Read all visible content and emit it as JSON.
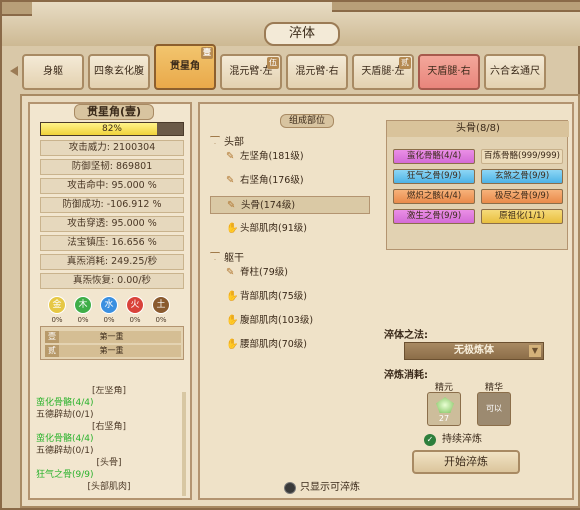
{
  "window": {
    "title": "淬体"
  },
  "tabs": [
    {
      "label": "身躯",
      "state": "normal"
    },
    {
      "label": "四象玄化腹",
      "state": "normal"
    },
    {
      "label": "贯星角",
      "state": "active",
      "badge": "壹"
    },
    {
      "label": "混元臂·左",
      "state": "normal",
      "badge": "伍"
    },
    {
      "label": "混元臂·右",
      "state": "normal"
    },
    {
      "label": "天盾腿·左",
      "state": "normal",
      "badge": "贰"
    },
    {
      "label": "天盾腿·右",
      "state": "red"
    },
    {
      "label": "六合玄通尺",
      "state": "normal"
    }
  ],
  "left": {
    "name": "贯星角(壹)",
    "progress": {
      "value": 82,
      "label": "82%"
    },
    "stats": [
      {
        "label": "攻击威力: 2100304"
      },
      {
        "label": "防御坚韧: 869801"
      },
      {
        "label": "攻击命中: 95.000 %"
      },
      {
        "label": "防御成功: -106.912 %"
      },
      {
        "label": "攻击穿透: 95.000 %"
      },
      {
        "label": "法宝镇压: 16.656 %"
      },
      {
        "label": "真炁消耗: 249.25/秒"
      },
      {
        "label": "真炁恢复: 0.00/秒"
      }
    ],
    "elements": [
      {
        "char": "金",
        "pct": "0%",
        "color": "#e6c845"
      },
      {
        "char": "木",
        "pct": "0%",
        "color": "#3fae48"
      },
      {
        "char": "水",
        "pct": "0%",
        "color": "#3a8fe0"
      },
      {
        "char": "火",
        "pct": "0%",
        "color": "#d9423a"
      },
      {
        "char": "土",
        "pct": "0%",
        "color": "#8a5a2e"
      }
    ],
    "seal_rows": [
      {
        "tag": "壹",
        "text": "第一重"
      },
      {
        "tag": "贰",
        "text": "第一重"
      }
    ],
    "log": [
      {
        "text": "[左坚角]",
        "type": "c"
      },
      {
        "text": "蛮化骨骼(4/4)",
        "type": "g"
      },
      {
        "text": "五德辟劫(0/1)",
        "type": "d"
      },
      {
        "text": "[右坚角]",
        "type": "c"
      },
      {
        "text": "蛮化骨骼(4/4)",
        "type": "g"
      },
      {
        "text": "五德辟劫(0/1)",
        "type": "d"
      },
      {
        "text": "[头骨]",
        "type": "c"
      },
      {
        "text": "狂气之骨(9/9)",
        "type": "g"
      },
      {
        "text": "[头部肌肉]",
        "type": "c"
      }
    ]
  },
  "right": {
    "parts_label": "组成部位",
    "groups": [
      {
        "name": "头部",
        "parts": [
          "左坚角(181级)",
          "右坚角(176级)",
          "头骨(174级)",
          "头部肌肉(91级)"
        ]
      },
      {
        "name": "躯干",
        "parts": [
          "脊柱(79级)",
          "背部肌肉(75级)",
          "腹部肌肉(103级)",
          "腰部肌肉(70级)"
        ]
      }
    ],
    "selected_part": "头骨(174级)",
    "bone_header": "头骨(8/8)",
    "bones": [
      {
        "label": "蛮化骨骼(4/4)",
        "style": "p"
      },
      {
        "label": "百炼骨骼(999/999)",
        "style": "bare"
      },
      {
        "label": "狂气之骨(9/9)",
        "style": "b"
      },
      {
        "label": "玄煞之骨(9/9)",
        "style": "b"
      },
      {
        "label": "燃炽之骸(4/4)",
        "style": "o"
      },
      {
        "label": "极尽之骨(9/9)",
        "style": "o"
      },
      {
        "label": "激生之骨(9/9)",
        "style": "p"
      },
      {
        "label": "原祖化(1/1)",
        "style": "y"
      }
    ],
    "method_label": "淬体之法:",
    "method_value": "无极炼体",
    "cost_label": "淬炼消耗:",
    "costs": [
      {
        "name": "精元",
        "count": "27"
      },
      {
        "name": "精华",
        "count": "可以"
      }
    ],
    "continuous_label": "持续淬炼",
    "start_button": "开始淬炼",
    "filter_label": "只显示可淬炼"
  }
}
